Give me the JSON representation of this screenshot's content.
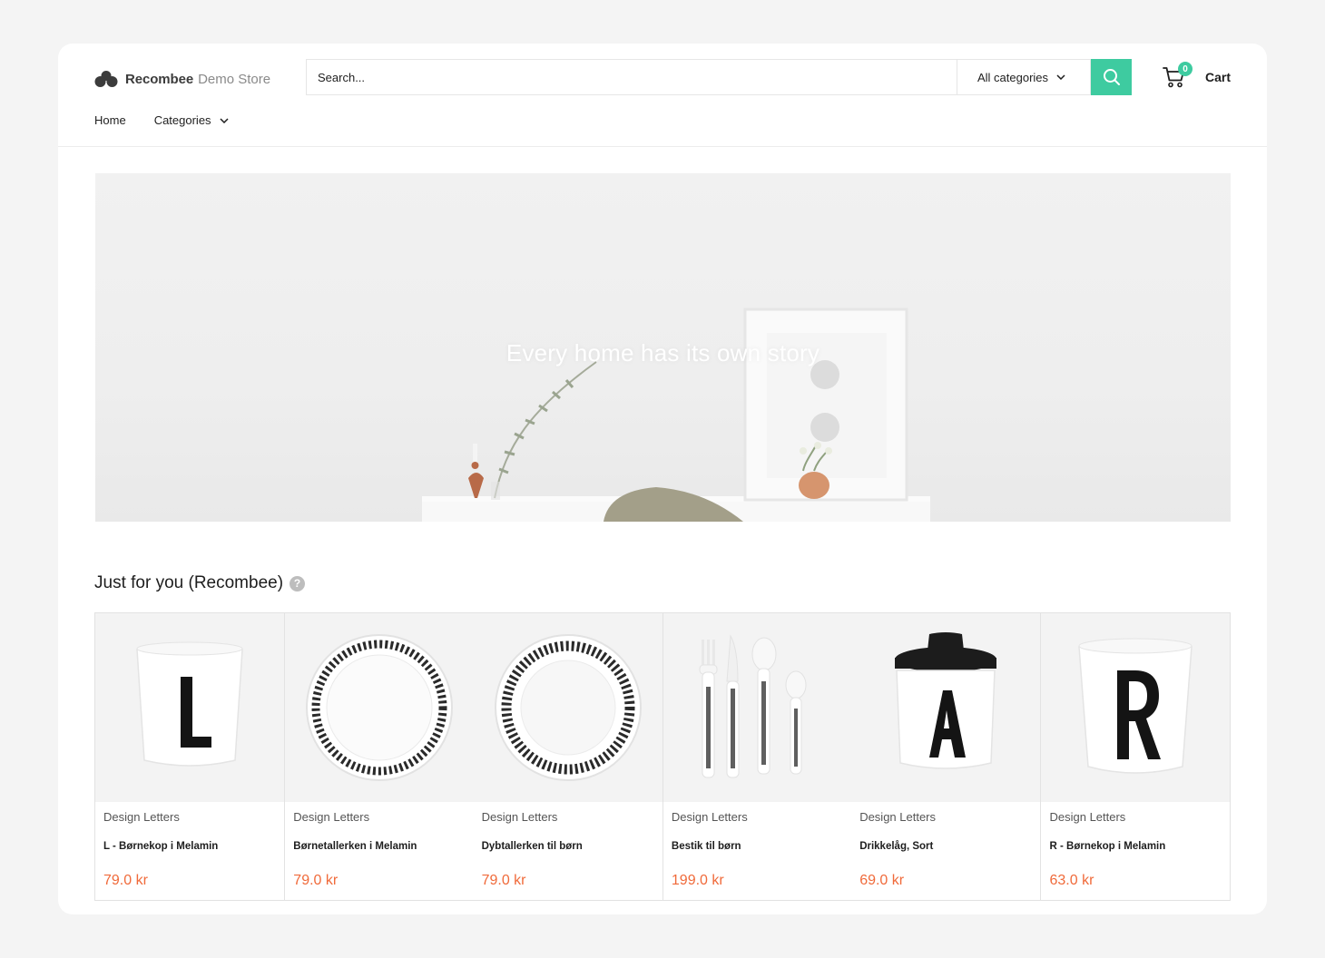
{
  "header": {
    "brand": "Recombee",
    "brand_suffix": "Demo Store",
    "search_placeholder": "Search...",
    "category_select": "All categories",
    "cart_count": "0",
    "cart_label": "Cart"
  },
  "nav": {
    "home": "Home",
    "categories": "Categories"
  },
  "hero": {
    "title": "Every home has its own story"
  },
  "section": {
    "title": "Just for you (Recombee)",
    "help": "?"
  },
  "products": [
    {
      "brand": "Design Letters",
      "name": "L - Børnekop i Melamin",
      "price": "79.0 kr",
      "image": "cup-letter-l"
    },
    {
      "brand": "Design Letters",
      "name": "Børnetallerken i Melamin",
      "price": "79.0 kr",
      "image": "alphabet-plate"
    },
    {
      "brand": "Design Letters",
      "name": "Dybtallerken til børn",
      "price": "79.0 kr",
      "image": "alphabet-bowl"
    },
    {
      "brand": "Design Letters",
      "name": "Bestik til børn",
      "price": "199.0 kr",
      "image": "cutlery-set"
    },
    {
      "brand": "Design Letters",
      "name": "Drikkelåg, Sort",
      "price": "69.0 kr",
      "image": "cup-letter-a-with-lid"
    },
    {
      "brand": "Design Letters",
      "name": "R - Børnekop i Melamin",
      "price": "63.0 kr",
      "image": "cup-letter-r"
    }
  ],
  "colors": {
    "accent": "#3ecba0",
    "price": "#f06a3a"
  }
}
